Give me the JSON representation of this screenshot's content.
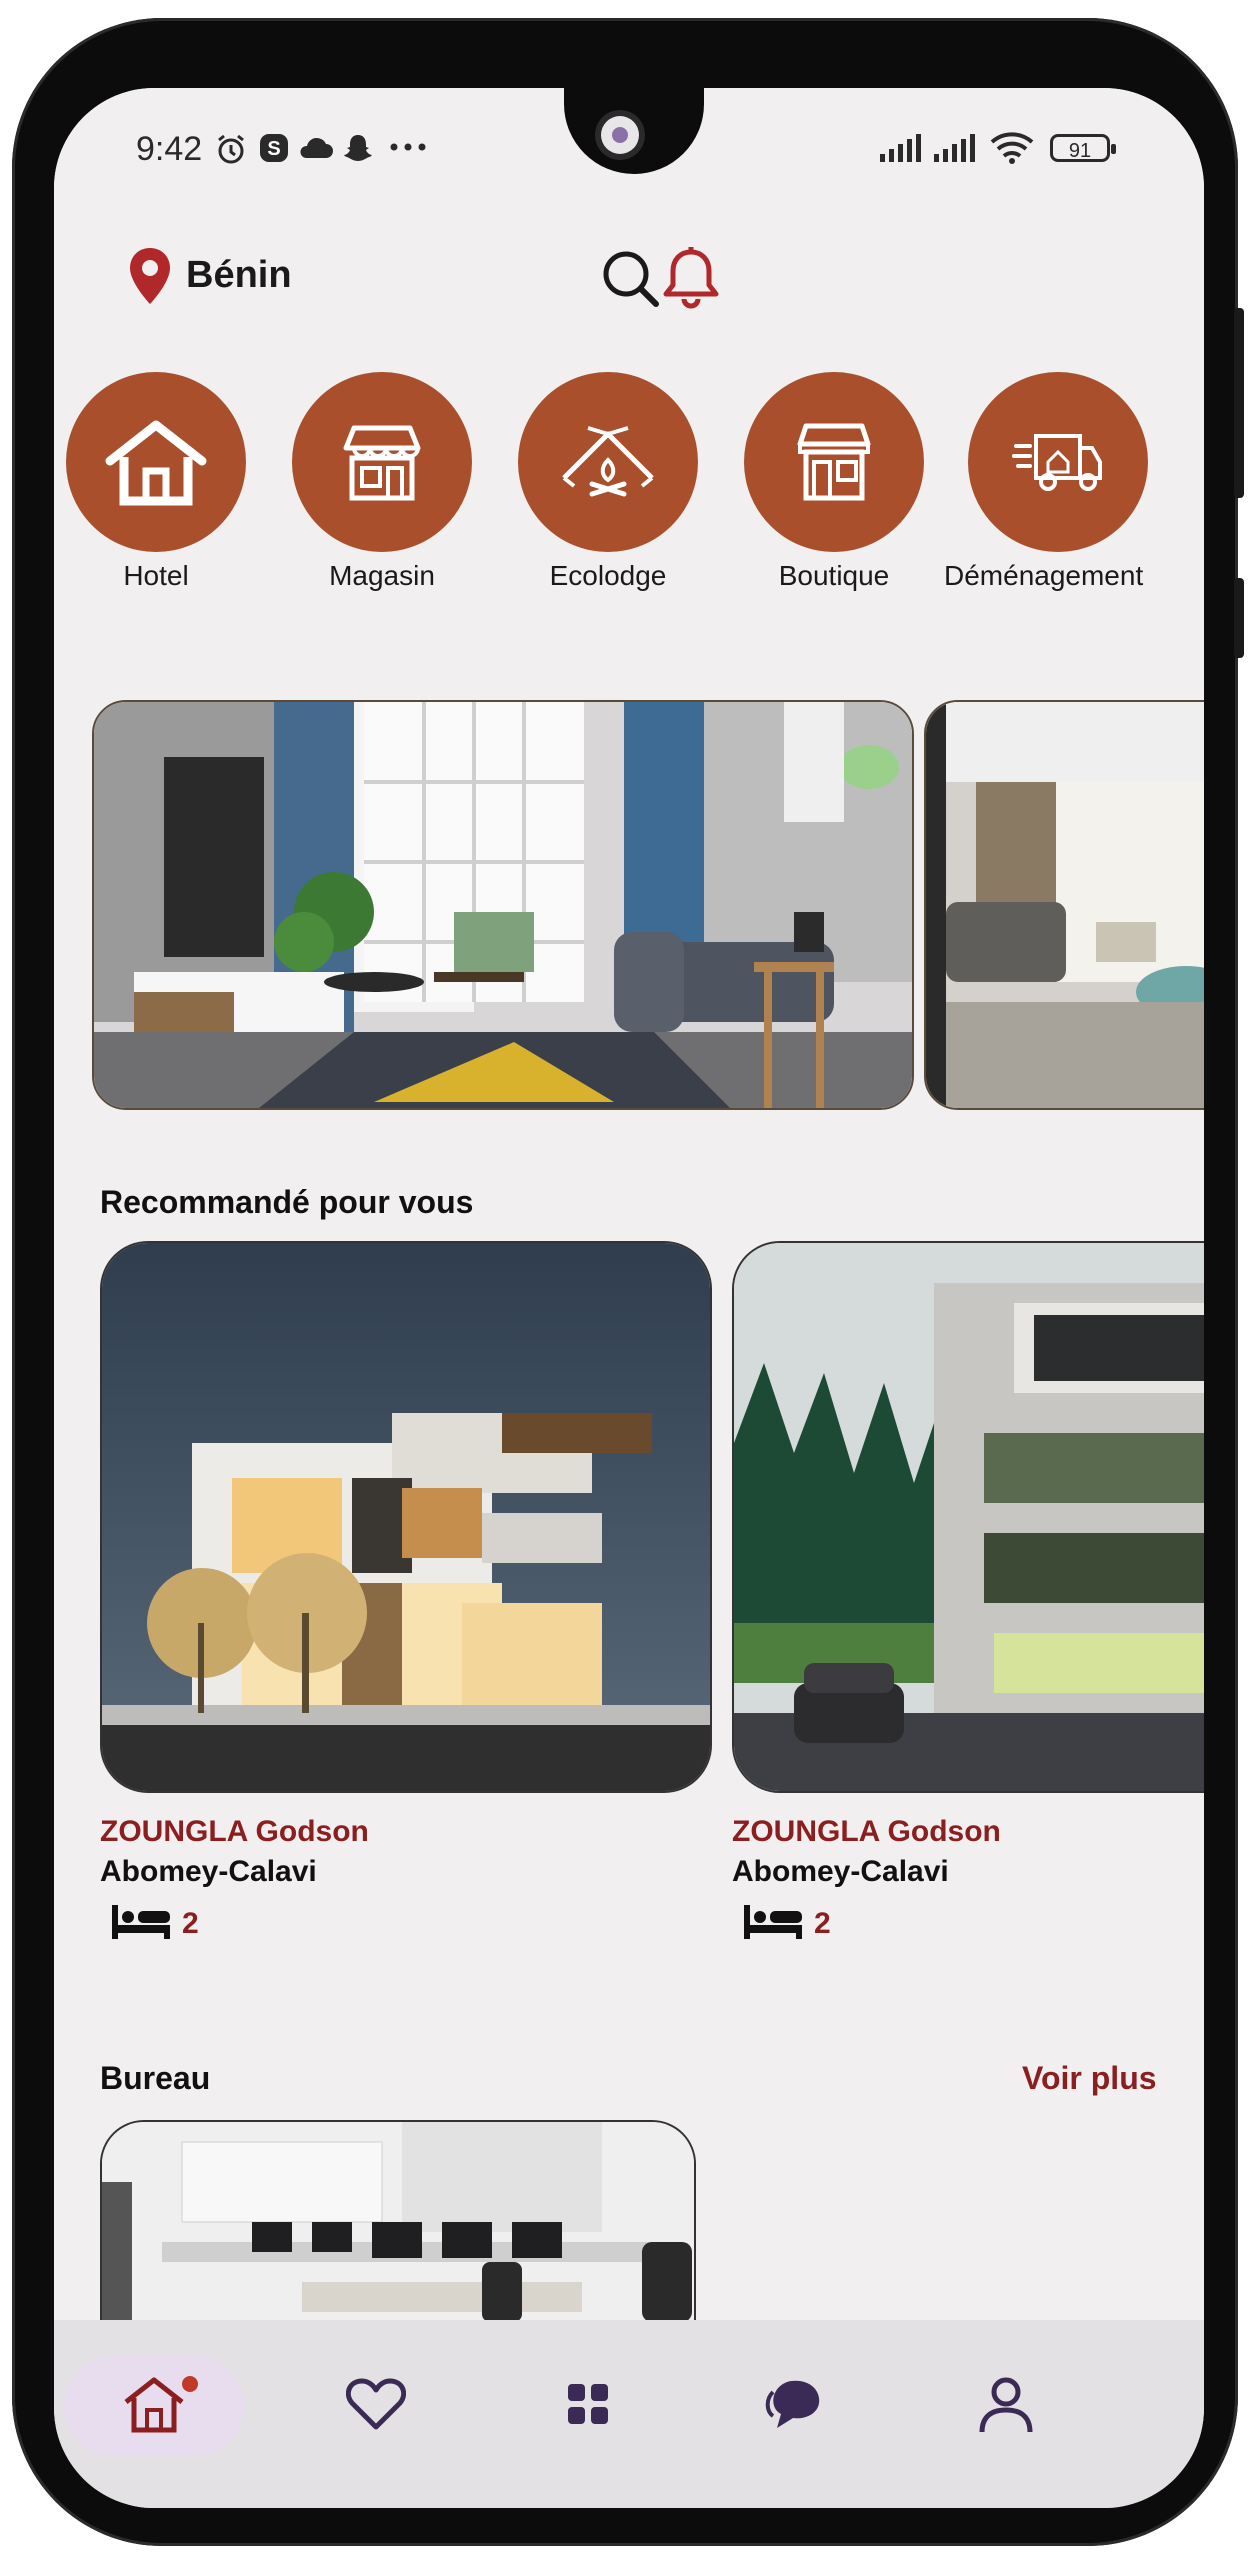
{
  "status_bar": {
    "time": "9:42",
    "battery": "91",
    "icons": [
      "alarm-icon",
      "skype-icon",
      "cloud-icon",
      "snapchat-icon",
      "more-dots-icon",
      "signal-icon",
      "signal-icon",
      "wifi-icon",
      "battery-icon"
    ]
  },
  "header": {
    "location": "Bénin",
    "icons": [
      "location-pin-icon",
      "search-icon",
      "bell-icon"
    ]
  },
  "categories": [
    {
      "label": "Hotel",
      "icon": "house-icon"
    },
    {
      "label": "Magasin",
      "icon": "store-icon"
    },
    {
      "label": "Ecolodge",
      "icon": "tent-icon"
    },
    {
      "label": "Boutique",
      "icon": "shop-icon"
    },
    {
      "label": "Déménagement",
      "icon": "moving-truck-icon"
    }
  ],
  "recommended": {
    "title": "Recommandé pour vous",
    "items": [
      {
        "owner": "ZOUNGLA Godson",
        "city": "Abomey-Calavi",
        "beds": "2"
      },
      {
        "owner": "ZOUNGLA Godson",
        "city": "Abomey-Calavi",
        "beds": "2"
      }
    ]
  },
  "bureau": {
    "title": "Bureau",
    "more": "Voir plus"
  },
  "bottom_nav": {
    "items": [
      "home-icon",
      "heart-icon",
      "grid-icon",
      "chat-icon",
      "user-icon"
    ],
    "active": "home-icon",
    "accent": "#a94f2c",
    "brand_red": "#8b1e1e"
  }
}
